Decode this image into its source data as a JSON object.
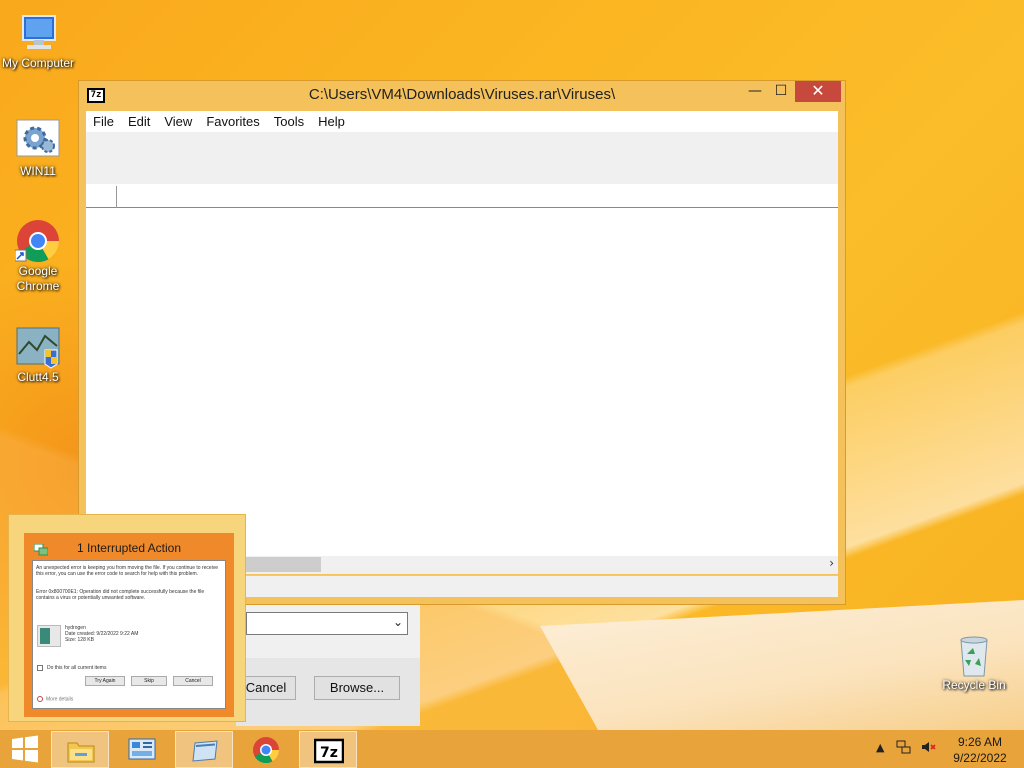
{
  "desktop": {
    "icons": [
      {
        "label": "My Computer",
        "icon": "computer-icon"
      },
      {
        "label": "WIN11",
        "icon": "settings-gear-icon"
      },
      {
        "label": "Google Chrome",
        "icon": "chrome-icon"
      },
      {
        "label": "Clutt4.5",
        "icon": "clutt-app-icon"
      },
      {
        "label": "Recycle Bin",
        "icon": "recycle-bin-icon"
      }
    ]
  },
  "archive_window": {
    "app_icon_text": "7z",
    "title": "C:\\Users\\VM4\\Downloads\\Viruses.rar\\Viruses\\",
    "controls": {
      "minimize": "—",
      "maximize": "☐",
      "close": "✕"
    },
    "menu": [
      "File",
      "Edit",
      "View",
      "Favorites",
      "Tools",
      "Help"
    ],
    "scroll_arrow": "›"
  },
  "extract_dialog": {
    "combo_value": "",
    "cancel_label": "Cancel",
    "browse_label": "Browse..."
  },
  "interrupted_preview": {
    "title": "1 Interrupted Action",
    "message": "An unexpected error is keeping you from moving the file. If you continue to receive this error, you can use the error code to search for help with this problem.",
    "error": "Error 0x800700E1: Operation did not complete successfully because the file contains a virus or potentially unwanted software.",
    "file_name": "hydrogen",
    "date_created": "Date created: 9/22/2022 9:22 AM",
    "size": "Size: 128 KB",
    "checkbox_label": "Do this for all current items",
    "buttons": [
      "Try Again",
      "Skip",
      "Cancel"
    ],
    "more_details": "More details"
  },
  "taskbar": {
    "items": [
      {
        "name": "file-explorer",
        "icon": "folder-icon",
        "active": true
      },
      {
        "name": "control-panel",
        "icon": "control-panel-icon",
        "active": false
      },
      {
        "name": "clutt-window",
        "icon": "window-icon",
        "active": false
      },
      {
        "name": "google-chrome",
        "icon": "chrome-icon",
        "active": false
      },
      {
        "name": "seven-zip",
        "icon": "seven-zip-icon",
        "active": false
      }
    ],
    "clock": {
      "time": "9:26 AM",
      "date": "9/22/2022"
    }
  },
  "colors": {
    "accent": "#f0892a",
    "close_button": "#c7483c",
    "taskbar": "#e8a43a"
  }
}
